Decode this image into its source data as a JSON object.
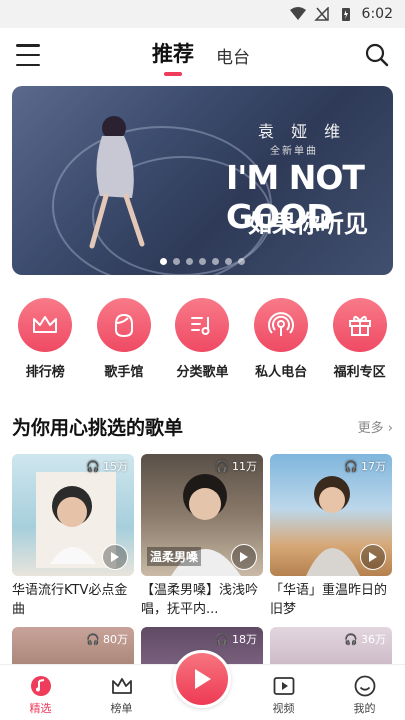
{
  "status_bar": {
    "time": "6:02"
  },
  "top_nav": {
    "tabs": [
      {
        "label": "推荐",
        "active": true
      },
      {
        "label": "电台",
        "active": false
      }
    ]
  },
  "banner": {
    "artist": "袁 娅 维",
    "subtitle": "全新单曲",
    "title": "I'M NOT GOOD",
    "title_cn": "如果你听见",
    "dot_count": 7,
    "active_dot": 0
  },
  "quick_entries": [
    {
      "label": "排行榜",
      "icon": "crown-icon"
    },
    {
      "label": "歌手馆",
      "icon": "singer-face-icon"
    },
    {
      "label": "分类歌单",
      "icon": "music-list-icon"
    },
    {
      "label": "私人电台",
      "icon": "radio-broadcast-icon"
    },
    {
      "label": "福利专区",
      "icon": "gift-icon"
    }
  ],
  "section": {
    "title": "为你用心挑选的歌单",
    "more": "更多"
  },
  "playlists": [
    {
      "title": "华语流行KTV必点金曲",
      "plays": "15万"
    },
    {
      "title": "【温柔男嗓】浅浅吟唱，抚平内...",
      "plays": "11万",
      "overlay": "温柔男嗓"
    },
    {
      "title": "「华语」重温昨日的旧梦",
      "plays": "17万"
    }
  ],
  "playlists_row2": [
    {
      "plays": "80万"
    },
    {
      "plays": "18万"
    },
    {
      "plays": "36万"
    }
  ],
  "bottom_nav": [
    {
      "label": "精选",
      "active": true
    },
    {
      "label": "榜单",
      "active": false
    },
    {
      "label": "视频",
      "active": false
    },
    {
      "label": "我的",
      "active": false
    }
  ],
  "colors": {
    "accent": "#ef3c5b"
  }
}
